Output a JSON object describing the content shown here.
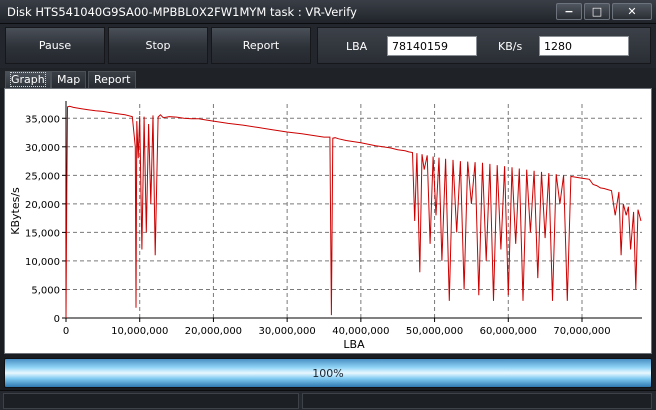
{
  "window": {
    "title": "Disk HTS541040G9SA00-MPBBL0X2FW1MYM   task : VR-Verify",
    "minimize": "−",
    "maximize": "□",
    "close": "✕"
  },
  "toolbar": {
    "pause_label": "Pause",
    "stop_label": "Stop",
    "report_label": "Report",
    "lba_label": "LBA",
    "lba_value": "78140159",
    "kbs_label": "KB/s",
    "kbs_value": "1280"
  },
  "tabs": [
    {
      "label": "Graph",
      "active": true
    },
    {
      "label": "Map",
      "active": false
    },
    {
      "label": "Report",
      "active": false
    }
  ],
  "progress": {
    "label": "100%",
    "value": 1.0
  },
  "chart_data": {
    "type": "line",
    "xlabel": "LBA",
    "ylabel": "KBytes/s",
    "xlim": [
      0,
      78140159
    ],
    "ylim": [
      0,
      37500
    ],
    "xticks": [
      0,
      10000000,
      20000000,
      30000000,
      40000000,
      50000000,
      60000000,
      70000000
    ],
    "xtick_labels": [
      "0",
      "10,000,000",
      "20,000,000",
      "30,000,000",
      "40,000,000",
      "50,000,000",
      "60,000,000",
      "70,000,000"
    ],
    "yticks": [
      0,
      5000,
      10000,
      15000,
      20000,
      25000,
      30000,
      35000
    ],
    "ytick_labels": [
      "0",
      "5,000",
      "10,000",
      "15,000",
      "20,000",
      "25,000",
      "30,000",
      "35,000"
    ],
    "grid": true,
    "series_color": "#cc0000",
    "series": [
      {
        "x": [
          0,
          100000,
          200000,
          500000,
          1000000,
          2000000,
          3000000,
          4000000,
          5000000,
          6000000,
          7000000,
          8000000,
          9000000,
          9400000,
          9500000,
          9600000,
          9800000,
          10000000,
          10300000,
          10600000,
          10900000,
          11200000,
          11500000,
          11800000,
          12100000,
          12500000,
          12800000,
          13200000,
          14000000,
          15000000,
          16000000,
          17000000,
          18000000,
          19000000,
          20000000,
          22000000,
          24000000,
          26000000,
          28000000,
          30000000,
          32000000,
          34000000,
          35000000,
          35800000,
          36000000,
          36200000,
          36500000,
          37000000,
          38000000,
          40000000,
          42000000,
          44000000,
          45000000,
          46000000,
          46500000,
          47000000,
          47300000,
          47600000,
          48000000,
          48300000,
          48600000,
          49000000,
          49400000,
          49800000,
          50200000,
          50600000,
          51000000,
          51500000,
          52000000,
          52500000,
          53000000,
          53500000,
          54000000,
          54500000,
          55000000,
          55500000,
          56000000,
          56500000,
          57000000,
          57500000,
          58000000,
          58500000,
          59000000,
          59500000,
          60000000,
          60500000,
          61000000,
          61500000,
          62000000,
          62500000,
          63000000,
          63500000,
          64000000,
          64500000,
          65000000,
          65500000,
          66000000,
          66500000,
          67000000,
          67500000,
          68000000,
          68500000,
          69000000,
          69500000,
          70000000,
          70500000,
          71000000,
          71500000,
          72000000,
          72500000,
          73000000,
          73500000,
          74000000,
          74500000,
          75000000,
          75300000,
          75600000,
          76000000,
          76300000,
          76600000,
          77000000,
          77300000,
          77600000,
          78000000
        ],
        "y": [
          0,
          20000,
          37000,
          37100,
          36900,
          36700,
          36500,
          36300,
          36200,
          36000,
          35800,
          35600,
          35300,
          30000,
          1800,
          34500,
          28000,
          35400,
          12000,
          35300,
          15000,
          34000,
          20000,
          35500,
          11000,
          35200,
          35600,
          35100,
          35300,
          35200,
          35000,
          34900,
          34900,
          34700,
          34500,
          34100,
          33800,
          33400,
          33000,
          32600,
          32300,
          31900,
          31700,
          31700,
          500,
          31500,
          31600,
          31400,
          31100,
          30700,
          30200,
          29800,
          29500,
          29300,
          29100,
          29000,
          17000,
          28900,
          8000,
          28700,
          26000,
          28500,
          13000,
          28300,
          18000,
          28100,
          10000,
          27900,
          3000,
          27700,
          15000,
          27500,
          5000,
          27400,
          20000,
          27300,
          4000,
          27200,
          10000,
          27000,
          3000,
          26800,
          12000,
          26600,
          4000,
          26400,
          13000,
          26200,
          3000,
          26000,
          15000,
          25800,
          7000,
          25600,
          14000,
          25400,
          3000,
          25200,
          20000,
          25000,
          3000,
          24800,
          24700,
          24600,
          24500,
          24400,
          24300,
          23400,
          23200,
          22800,
          22700,
          22500,
          22300,
          18000,
          22100,
          11000,
          20000,
          18000,
          19500,
          12000,
          18600,
          5000,
          19000,
          17000
        ]
      }
    ]
  }
}
